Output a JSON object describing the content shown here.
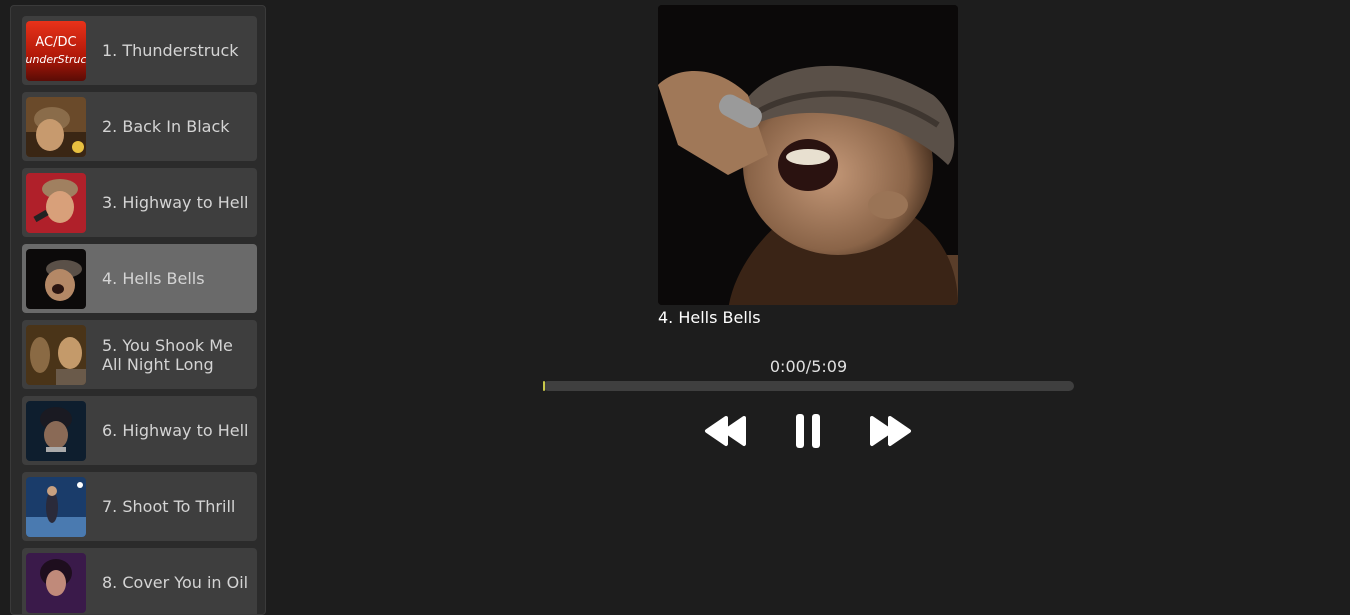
{
  "playlist": {
    "items": [
      {
        "label": "1. Thunderstruck",
        "thumb_text_top": "AC/DC",
        "thumb_text_bottom": "underStruc"
      },
      {
        "label": "2. Back In Black"
      },
      {
        "label": "3. Highway to Hell"
      },
      {
        "label": "4. Hells Bells",
        "active": true
      },
      {
        "label": "5. You Shook Me All Night Long"
      },
      {
        "label": "6. Highway to Hell"
      },
      {
        "label": "7. Shoot To Thrill"
      },
      {
        "label": "8. Cover You in Oil"
      }
    ]
  },
  "player": {
    "now_playing": "4. Hells Bells",
    "time": "0:00/5:09",
    "progress_fraction": 0.0,
    "controls": {
      "rewind_icon": "rewind-icon",
      "pause_icon": "pause-icon",
      "forward_icon": "fast-forward-icon"
    }
  },
  "colors": {
    "background": "#1d1d1d",
    "active_item": "#6a6a6a",
    "progress_accent": "#c8c84a"
  }
}
